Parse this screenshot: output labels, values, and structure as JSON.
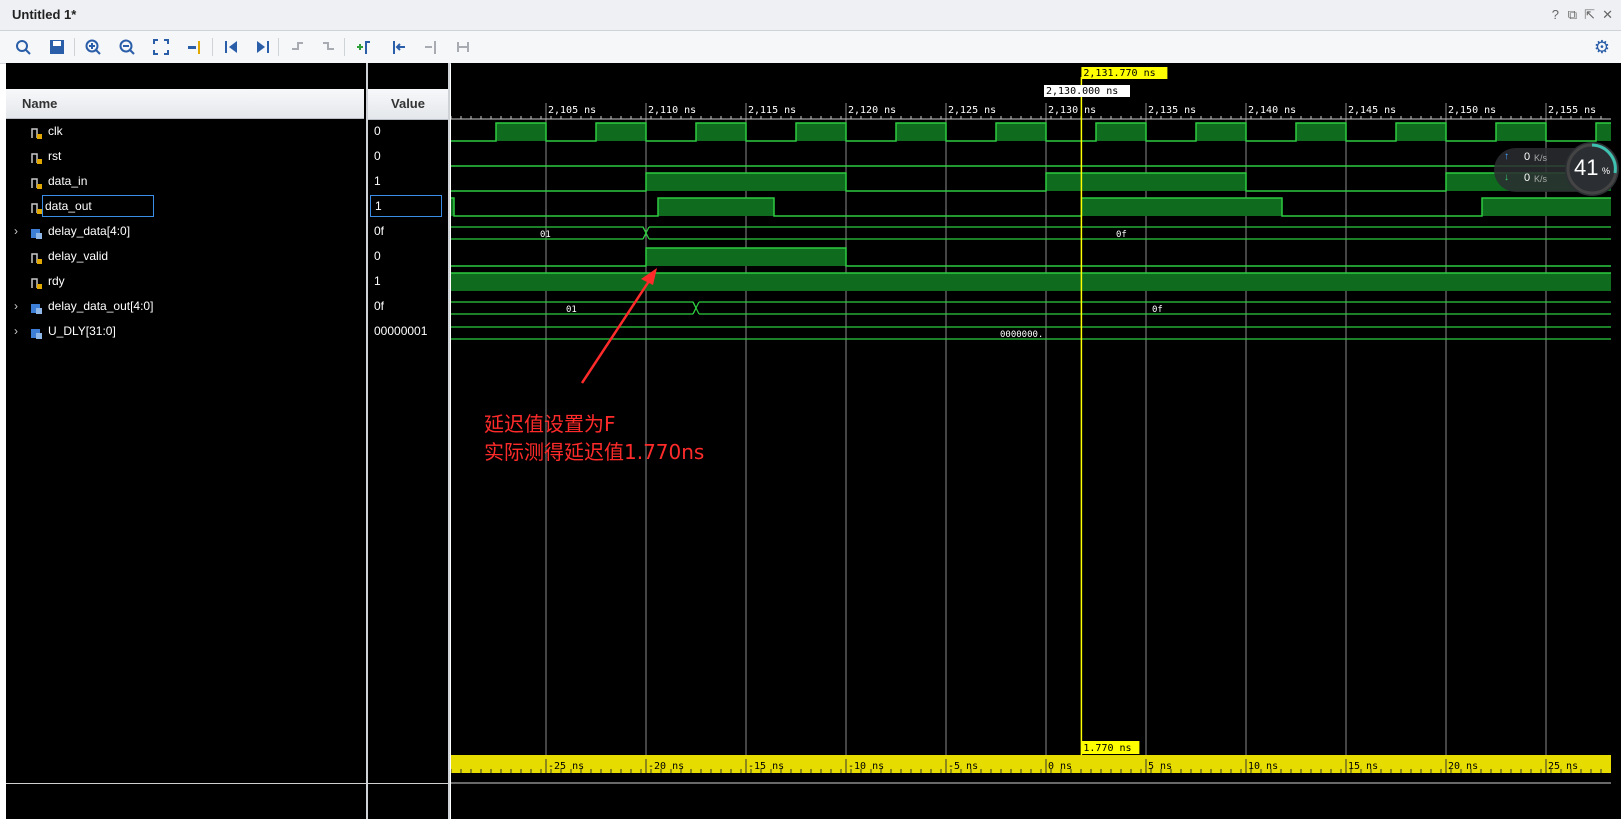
{
  "window": {
    "title": "Untitled 1*"
  },
  "toolbar": {
    "buttons": [
      "search-icon",
      "save-icon",
      "zoom-in-icon",
      "zoom-out-icon",
      "zoom-fit-icon",
      "go-to-cursor-icon",
      "go-to-start-icon",
      "go-to-end-icon",
      "previous-transition-icon",
      "next-transition-icon",
      "add-marker-icon",
      "previous-marker-icon",
      "next-marker-icon",
      "swap-cursors-icon"
    ],
    "settings_icon": "gear-icon"
  },
  "columns": {
    "name": "Name",
    "value": "Value"
  },
  "signals": [
    {
      "name": "clk",
      "value": "0",
      "kind": "bit"
    },
    {
      "name": "rst",
      "value": "0",
      "kind": "bit"
    },
    {
      "name": "data_in",
      "value": "1",
      "kind": "bit"
    },
    {
      "name": "data_out",
      "value": "1",
      "kind": "bit",
      "selected": true
    },
    {
      "name": "delay_data[4:0]",
      "value": "0f",
      "kind": "bus"
    },
    {
      "name": "delay_valid",
      "value": "0",
      "kind": "bit"
    },
    {
      "name": "rdy",
      "value": "1",
      "kind": "bit"
    },
    {
      "name": "delay_data_out[4:0]",
      "value": "0f",
      "kind": "bus"
    },
    {
      "name": "U_DLY[31:0]",
      "value": "00000001",
      "kind": "bus"
    }
  ],
  "timeline": {
    "ticks": [
      "2,105 ns",
      "2,110 ns",
      "2,115 ns",
      "2,120 ns",
      "2,125 ns",
      "2,130 ns",
      "2,135 ns",
      "2,140 ns",
      "2,145 ns",
      "2,150 ns",
      "2,155 ns"
    ],
    "cursor_main": "2,131.770 ns",
    "cursor_ref": "2,130.000 ns",
    "delta": "1.770 ns",
    "rel_ticks": [
      "-25 ns",
      "-20 ns",
      "-15 ns",
      "-10 ns",
      "-5 ns",
      "0 ns",
      "5 ns",
      "10 ns",
      "15 ns",
      "20 ns",
      "25 ns"
    ]
  },
  "bus_labels": {
    "delay_data_a": "01",
    "delay_data_b": "0f",
    "delay_data_out_a": "01",
    "delay_data_out_b": "0f",
    "u_dly": "0000000."
  },
  "annotation": {
    "line1": "延迟值设置为F",
    "line2": "实际测得延迟值1.770ns",
    "color": "#ff2b2b"
  },
  "net_widget": {
    "up": "0",
    "down": "0",
    "unit": "K/s",
    "percent": "41",
    "pct_sign": "%"
  },
  "colors": {
    "wave": "#2ecc40",
    "wave_fill": "#0f6b1e",
    "cursor": "#ffff00",
    "marker_bar": "#e6dc00"
  }
}
